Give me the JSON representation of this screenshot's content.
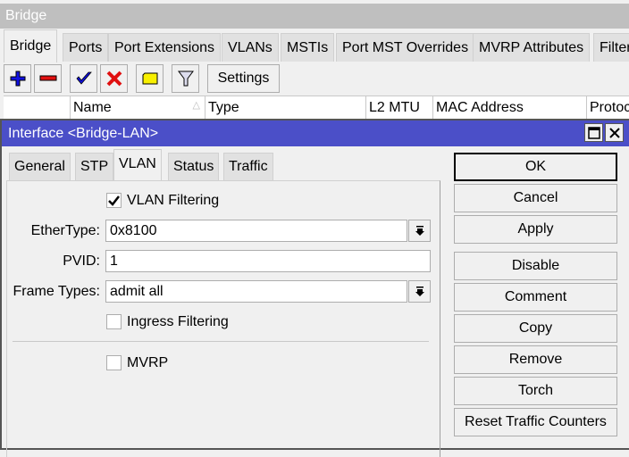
{
  "bridge_window": {
    "title": "Bridge",
    "tabs": [
      {
        "label": "Bridge",
        "active": true
      },
      {
        "label": "Ports"
      },
      {
        "label": "Port Extensions"
      },
      {
        "label": "VLANs"
      },
      {
        "label": "MSTIs"
      },
      {
        "label": "Port MST Overrides"
      },
      {
        "label": "MVRP Attributes"
      },
      {
        "label": "Filters"
      }
    ],
    "toolbar": {
      "icons": [
        "add-icon",
        "remove-icon",
        "enable-icon",
        "disable-icon",
        "comment-icon",
        "filter-icon"
      ],
      "settings_label": "Settings"
    },
    "columns": [
      "",
      "Name",
      "Type",
      "L2 MTU",
      "MAC Address",
      "Protocol"
    ]
  },
  "dialog": {
    "title": "Interface <Bridge-LAN>",
    "tabs": [
      {
        "label": "General"
      },
      {
        "label": "STP"
      },
      {
        "label": "VLAN",
        "active": true
      },
      {
        "label": "Status"
      },
      {
        "label": "Traffic"
      }
    ],
    "vlan_filtering": {
      "label": "VLAN Filtering",
      "checked": true
    },
    "ethertype": {
      "label": "EtherType:",
      "value": "0x8100"
    },
    "pvid": {
      "label": "PVID:",
      "value": "1"
    },
    "frame_types": {
      "label": "Frame Types:",
      "value": "admit all"
    },
    "ingress_filtering": {
      "label": "Ingress Filtering",
      "checked": false
    },
    "mvrp": {
      "label": "MVRP",
      "checked": false
    },
    "buttons": [
      "OK",
      "Cancel",
      "Apply",
      "Disable",
      "Comment",
      "Copy",
      "Remove",
      "Torch",
      "Reset Traffic Counters"
    ]
  },
  "colors": {
    "title_bar": "#4b4fc8",
    "inactive_title": "#bfbfbf"
  }
}
